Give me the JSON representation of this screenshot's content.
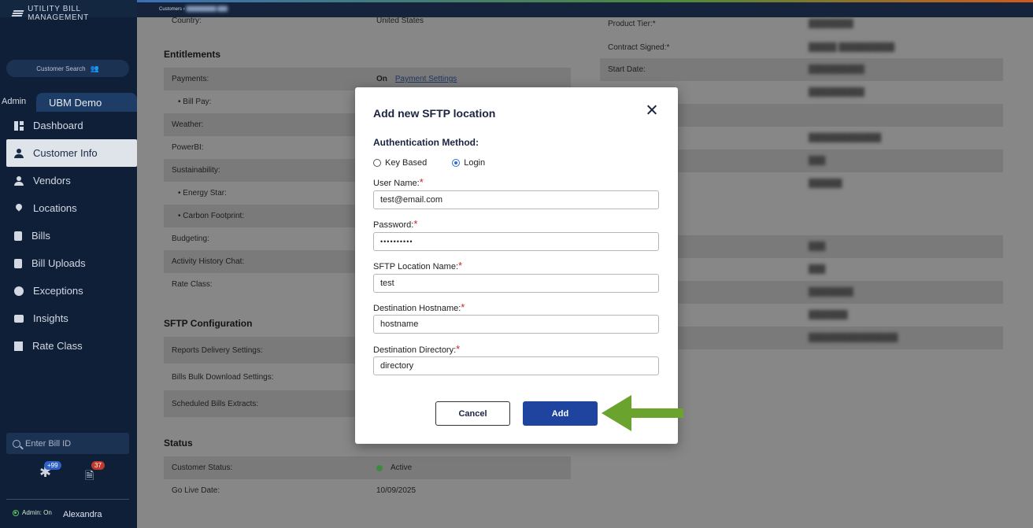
{
  "sidebar": {
    "brand": "UTILITY BILL MANAGEMENT",
    "customer_search": "Customer Search",
    "admin_label": "Admin",
    "tenant_tab": "UBM Demo",
    "nav": [
      {
        "label": "Dashboard",
        "icon": "dashboard-icon"
      },
      {
        "label": "Customer Info",
        "icon": "person-icon"
      },
      {
        "label": "Vendors",
        "icon": "person-icon"
      },
      {
        "label": "Locations",
        "icon": "location-pin-icon"
      },
      {
        "label": "Bills",
        "icon": "document-icon"
      },
      {
        "label": "Bill Uploads",
        "icon": "upload-icon"
      },
      {
        "label": "Exceptions",
        "icon": "exclamation-icon"
      },
      {
        "label": "Insights",
        "icon": "chat-icon"
      },
      {
        "label": "Rate Class",
        "icon": "building-icon"
      }
    ],
    "bill_id_placeholder": "Enter Bill ID",
    "notif_count_1": "+99",
    "notif_count_2": "37",
    "admin_toggle": "Admin: On",
    "user_name": "Alexandra"
  },
  "topbar": {
    "breadcrumb": "Customers ›"
  },
  "main": {
    "country": {
      "label": "Country:",
      "value": "United States"
    },
    "entitlements_title": "Entitlements",
    "entitlements": [
      {
        "label": "Payments:",
        "value": "On",
        "link": "Payment Settings"
      },
      {
        "label": "• Bill Pay:"
      },
      {
        "label": "Weather:"
      },
      {
        "label": "PowerBI:"
      },
      {
        "label": "Sustainability:"
      },
      {
        "label": "• Energy Star:"
      },
      {
        "label": "• Carbon Footprint:"
      },
      {
        "label": "Budgeting:"
      },
      {
        "label": "Activity History Chat:"
      },
      {
        "label": "Rate Class:"
      }
    ],
    "sftp_title": "SFTP Configuration",
    "sftp": [
      {
        "label": "Reports Delivery Settings:"
      },
      {
        "label": "Bills Bulk Download Settings:"
      },
      {
        "label": "Scheduled Bills Extracts:"
      }
    ],
    "status_title": "Status",
    "status": [
      {
        "label": "Customer Status:",
        "value": "Active"
      },
      {
        "label": "Go Live Date:",
        "value": "10/09/2025"
      }
    ],
    "right": [
      {
        "label": "Product Tier:*"
      },
      {
        "label": "Contract Signed:*"
      },
      {
        "label": "Start Date:"
      }
    ]
  },
  "modal": {
    "title": "Add new SFTP location",
    "auth_title": "Authentication Method:",
    "option_key": "Key Based",
    "option_login": "Login",
    "username_label": "User Name:",
    "username_value": "test@email.com",
    "password_label": "Password:",
    "password_value": "••••••••••",
    "sftp_name_label": "SFTP Location Name:",
    "sftp_name_value": "test",
    "hostname_label": "Destination Hostname:",
    "hostname_value": "hostname",
    "directory_label": "Destination Directory:",
    "directory_value": "directory",
    "required_mark": "*",
    "cancel": "Cancel",
    "add": "Add"
  },
  "colors": {
    "primary": "#1e44a0",
    "sidebar": "#0f1f38",
    "arrow": "#6aa32e",
    "required": "#c62828"
  }
}
